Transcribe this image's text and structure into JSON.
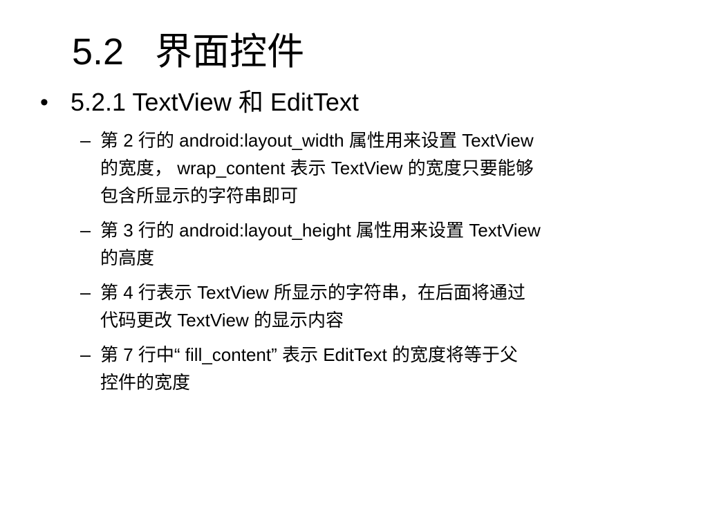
{
  "slide": {
    "title": "5.2   界面控件",
    "bullet": {
      "symbol": "•",
      "text": "5.2.1 TextView 和 EditText"
    },
    "items": [
      {
        "dash": "–",
        "lines": [
          "第 2 行的 android:layout_width 属性用来设置 TextView",
          "的宽度， wrap_content 表示 TextView 的宽度只要能够",
          "包含所显示的字符串即可"
        ]
      },
      {
        "dash": "–",
        "lines": [
          "第 3 行的 android:layout_height 属性用来设置 TextView",
          "的高度"
        ]
      },
      {
        "dash": "–",
        "lines": [
          "第 4 行表示 TextView 所显示的字符串，在后面将通过",
          "代码更改 TextView 的显示内容"
        ]
      },
      {
        "dash": "–",
        "lines": [
          "第 7 行中“ fill_content” 表示 EditText 的宽度将等于父",
          "控件的宽度"
        ]
      }
    ]
  }
}
